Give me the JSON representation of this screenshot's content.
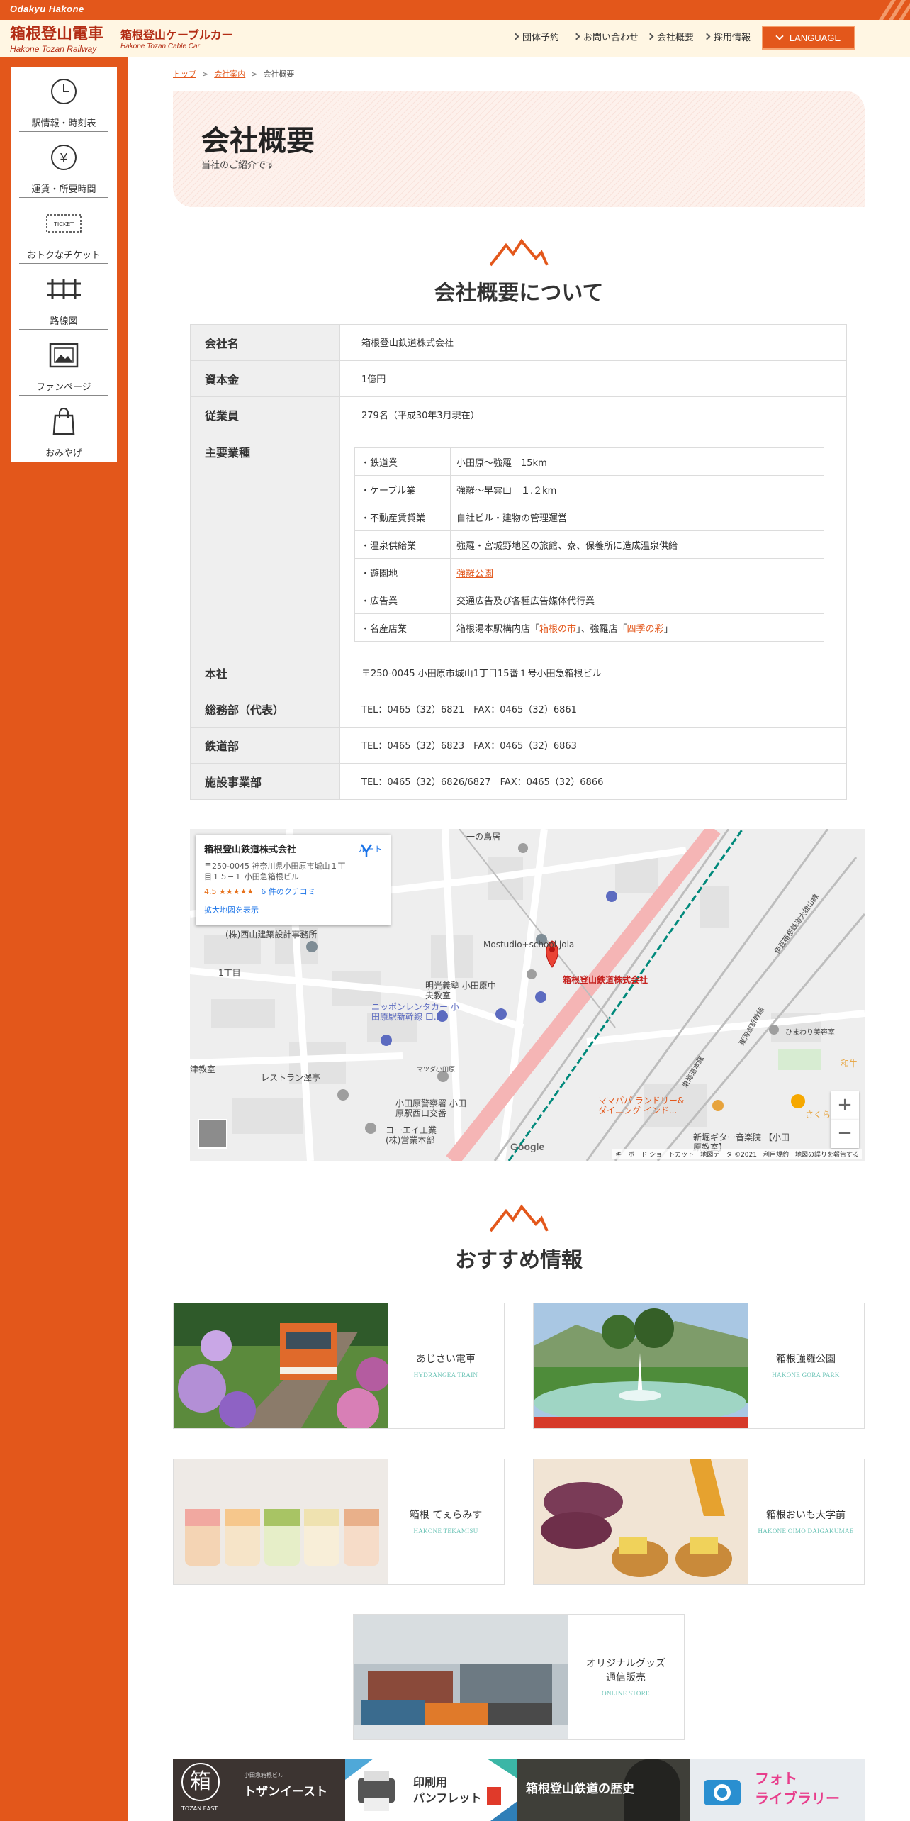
{
  "brand": {
    "en_top": "Odakyu Hakone",
    "main_jp": "箱根登山電車",
    "main_en": "Hakone Tozan Railway",
    "cable_jp": "箱根登山ケーブルカー",
    "cable_en": "Hakone Tozan Cable Car"
  },
  "header_nav": [
    "団体予約",
    "お問い合わせ",
    "会社概要",
    "採用情報"
  ],
  "language_label": "LANGUAGE",
  "side_menu": [
    {
      "label": "駅情報・時刻表",
      "icon": "clock-icon"
    },
    {
      "label": "運賃・所要時間",
      "icon": "yen-icon"
    },
    {
      "label": "おトクなチケット",
      "icon": "ticket-icon",
      "icon_text": "TICKET"
    },
    {
      "label": "路線図",
      "icon": "railway-track-icon"
    },
    {
      "label": "ファンページ",
      "icon": "photo-frame-icon"
    },
    {
      "label": "おみやげ",
      "icon": "shopping-bag-icon"
    }
  ],
  "breadcrumb": [
    "トップ",
    "会社案内",
    "会社概要"
  ],
  "hero": {
    "title": "会社概要",
    "subtitle": "当社のご紹介です"
  },
  "section_company_title": "会社概要について",
  "company": {
    "name_label": "会社名",
    "name_value": "箱根登山鉄道株式会社",
    "capital_label": "資本金",
    "capital_value": "1億円",
    "employees_label": "従業員",
    "employees_value": "279名（平成30年3月現在）",
    "business_label": "主要業種",
    "business": [
      {
        "key": "・鉄道業",
        "value": "小田原〜強羅　15km"
      },
      {
        "key": "・ケーブル業",
        "value": "強羅〜早雲山　１.２km"
      },
      {
        "key": "・不動産賃貸業",
        "value": "自社ビル・建物の管理運営"
      },
      {
        "key": "・温泉供給業",
        "value": "強羅・宮城野地区の旅館、寮、保養所に造成温泉供給"
      },
      {
        "key": "・遊園地",
        "value": "",
        "link": "強羅公園"
      },
      {
        "key": "・広告業",
        "value": "交通広告及び各種広告媒体代行業"
      },
      {
        "key": "・名産店業",
        "pre": "箱根湯本駅構内店「",
        "link1": "箱根の市",
        "mid": "」、強羅店「",
        "link2": "四季の彩",
        "post": "」"
      }
    ],
    "hq_label": "本社",
    "hq_value": "〒250-0045 小田原市城山1丁目15番１号小田急箱根ビル",
    "general_label": "総務部（代表）",
    "general_value": "TEL：0465（32）6821　FAX：0465（32）6861",
    "rail_label": "鉄道部",
    "rail_value": "TEL：0465（32）6823　FAX：0465（32）6863",
    "facility_label": "施設事業部",
    "facility_value": "TEL：0465（32）6826/6827　FAX：0465（32）6866"
  },
  "map": {
    "card_name": "箱根登山鉄道株式会社",
    "card_address": "〒250-0045 神奈川県小田原市城山１丁目１５−１ 小田急箱根ビル",
    "rating": "4.5 ★★★★★",
    "reviews": "6 件のクチコミ",
    "route_label": "ルート",
    "larger_map": "拡大地図を表示",
    "pin_label": "箱根登山鉄道株式会社",
    "footer": "キーボード ショートカット　地図データ ©2021　利用規約　地図の誤りを報告する",
    "google": "Google",
    "labels": [
      "(株)西山建築設計事務所",
      "明光義塾 小田原中央教室",
      "ニッポンレンタカー 小田原駅新幹線 口...",
      "レストラン澤亭",
      "小田原警察署 小田原駅西口交番",
      "コーエイ工業 (株)営業本部",
      "ママパパ ランドリー& ダイニング インド...",
      "新堀ギター音楽院 【小田原教室】",
      "ひまわり美容室",
      "さくら",
      "和牛",
      "Mostudio+school joia",
      "マツダ小田原",
      "1丁目",
      "津教室",
      "一の鳥居",
      "伊豆箱根鉄道大雄山線",
      "東海道本線",
      "東海道新幹線"
    ]
  },
  "section_recommend_title": "おすすめ情報",
  "recommend": [
    {
      "jp": "あじさい電車",
      "en": "HYDRANGEA TRAIN"
    },
    {
      "jp": "箱根強羅公園",
      "en": "HAKONE GORA PARK"
    },
    {
      "jp": "箱根 てぇらみす",
      "en": "HAKONE TEKAMISU"
    },
    {
      "jp": "箱根おいも大学前",
      "en": "HAKONE OIMO DAIGAKUMAE"
    },
    {
      "jp": "オリジナルグッズ通信販売",
      "jp_line1": "オリジナルグッズ",
      "jp_line2": "通信販売",
      "en": "ONLINE STORE"
    }
  ],
  "banners": [
    {
      "title": "トザンイースト",
      "sub": "小田急箱根ビル",
      "tag": "TOZAN EAST",
      "logo_char": "箱"
    },
    {
      "title": "印刷用",
      "title2": "パンフレット"
    },
    {
      "title": "箱根登山鉄道の歴史"
    },
    {
      "title": "フォト",
      "title2": "ライブラリー"
    }
  ],
  "colors": {
    "brand_orange": "#e3571b",
    "header_bg": "#fff6e3",
    "accent_teal": "#6dc4b7"
  }
}
